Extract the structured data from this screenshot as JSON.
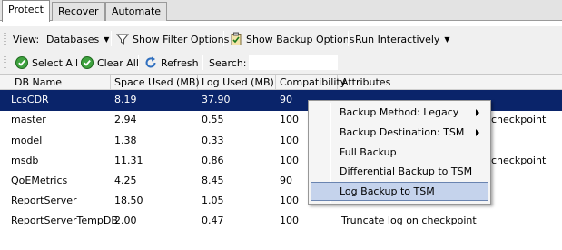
{
  "tabs": [
    {
      "label": "Protect"
    },
    {
      "label": "Recover"
    },
    {
      "label": "Automate"
    }
  ],
  "toolbar1": {
    "view_label": "View:",
    "view_value": "Databases",
    "filter_label": "Show Filter Options",
    "backup_options_label": "Show Backup Options",
    "run_label": "Run Interactively"
  },
  "toolbar2": {
    "select_all_label": "Select All",
    "clear_all_label": "Clear All",
    "refresh_label": "Refresh",
    "search_label": "Search:",
    "search_value": ""
  },
  "table": {
    "columns": [
      "DB Name",
      "Space Used (MB)",
      "Log Used (MB)",
      "Compatibility",
      "Attributes"
    ],
    "rows": [
      {
        "name": "LcsCDR",
        "space": "8.19",
        "log": "37.90",
        "compat": "90",
        "attributes": ""
      },
      {
        "name": "master",
        "space": "2.94",
        "log": "0.55",
        "compat": "100",
        "attributes": "checkpoint"
      },
      {
        "name": "model",
        "space": "1.38",
        "log": "0.33",
        "compat": "100",
        "attributes": ""
      },
      {
        "name": "msdb",
        "space": "11.31",
        "log": "0.86",
        "compat": "100",
        "attributes": "checkpoint"
      },
      {
        "name": "QoEMetrics",
        "space": "4.25",
        "log": "8.45",
        "compat": "90",
        "attributes": ""
      },
      {
        "name": "ReportServer",
        "space": "18.50",
        "log": "1.05",
        "compat": "100",
        "attributes": ""
      },
      {
        "name": "ReportServerTempDB",
        "space": "2.00",
        "log": "0.47",
        "compat": "100",
        "attributes": "Truncate log on checkpoint"
      }
    ]
  },
  "context_menu": {
    "items": [
      {
        "label": "Backup Method: Legacy"
      },
      {
        "label": "Backup Destination: TSM"
      },
      {
        "label": "Full Backup"
      },
      {
        "label": "Differential Backup to TSM"
      },
      {
        "label": "Log Backup to TSM"
      }
    ]
  },
  "colors": {
    "selection": "#0a246a",
    "menu_highlight": "#c5d3ec",
    "toolbar_bg": "#f0f0f0"
  }
}
